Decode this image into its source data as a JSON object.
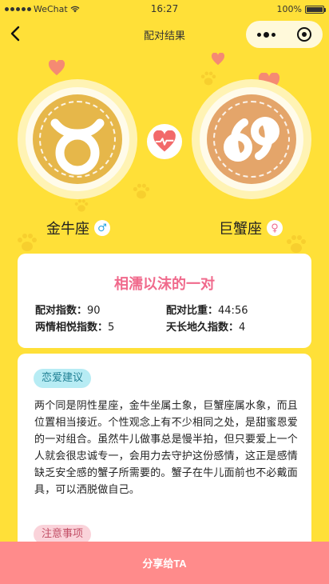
{
  "status_bar": {
    "carrier": "WeChat",
    "time": "16:27",
    "battery": "100%"
  },
  "nav": {
    "title": "配对结果"
  },
  "signs": {
    "left": {
      "name": "金牛座",
      "gender_symbol": "♂",
      "glyph": "taurus-icon",
      "color": "#E6B74A"
    },
    "right": {
      "name": "巨蟹座",
      "gender_symbol": "♀",
      "glyph": "cancer-icon",
      "color": "#E4A56A"
    }
  },
  "summary": {
    "title": "相濡以沫的一对",
    "match_index_label": "配对指数：",
    "match_index_value": "90",
    "ratio_label": "配对比重：",
    "ratio_value": "44:56",
    "harmony_label": "两情相悦指数：",
    "harmony_value": "5",
    "forever_label": "天长地久指数：",
    "forever_value": "4"
  },
  "advice": {
    "tag": "恋爱建议",
    "text": "两个同是阴性星座，金牛坐属土象，巨蟹座属水象，而且位置相当接近。个性观念上有不少相同之处，是甜蜜恩爱的一对组合。虽然牛儿做事总是慢半拍，但只要爱上一个人就会很忠诚专一，会用力去守护这份感情，这正是感情缺乏安全感的蟹子所需要的。蟹子在牛儿面前也不必戴面具，可以洒脱做自己。",
    "note_tag": "注意事项"
  },
  "share": {
    "label": "分享给TA"
  },
  "colors": {
    "background": "#FFE038",
    "title_pink": "#F06A8C",
    "share_bar": "#FF8B8B",
    "heart": "#F26A6A",
    "male_blue": "#2AA5E0",
    "female_pink": "#F06A8C"
  }
}
